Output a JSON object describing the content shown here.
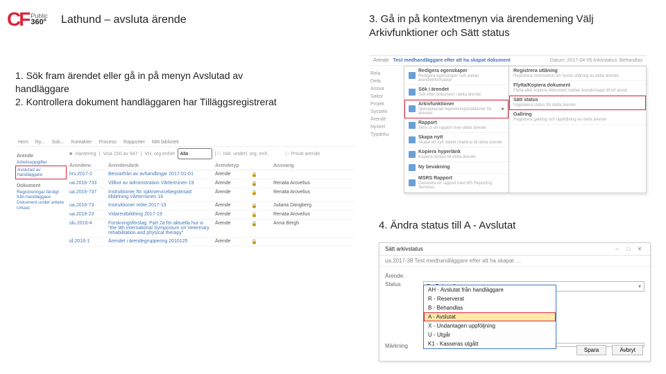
{
  "logo": {
    "mark": "CF",
    "sup": "Public",
    "num": "360°"
  },
  "title": "Lathund – avsluta ärende",
  "step1_lines": "1. Sök fram ärendet eller gå in på menyn Avslutad av handläggare\n2. Kontrollera dokument handläggaren har Tilläggsregistrerat",
  "step3_lines": "3. Gå in på kontextmenyn via ärendemening Välj Arkivfunktioner och Sätt status",
  "step4_lines": "4. Ändra status till A - Avslutat",
  "shot1": {
    "top_tabs": [
      "Hem",
      "Ny...",
      "Sök...",
      "Kontakter",
      "Process",
      "Rapporter",
      "Mitt bibliotek"
    ],
    "side_header": "Ärende",
    "side_items": [
      "Arbetsuppgifter"
    ],
    "side_selected": "Avslutad av handläggare",
    "side_items2": [
      "Dokument",
      "Registreringar färdigt från handläggare",
      "Dokument under arbete",
      "Urkast"
    ],
    "filter": {
      "label": "Hantering",
      "vis": "Visa 150 av 947",
      "scope": "VH, org.enhet",
      "kind": "Alla",
      "check": "Inkl. underl. org. enh.",
      "check2": "Privat arende"
    },
    "cols": [
      "Ärendenr.",
      "Ärenderubrik",
      "Ärendetyp",
      "",
      "Ansvarig"
    ],
    "rows": [
      {
        "id": "hrv.2017-2",
        "t": "Besvarfrån av avhandlingar 2017-01-01",
        "ty": "Ärende",
        "a": ""
      },
      {
        "id": "ua.2016-733",
        "t": "Villkor av administration Vårterminen 19",
        "ty": "Ärende",
        "a": "Renata Arovelius"
      },
      {
        "id": "ua.2016-737",
        "t": "Instruktioner för självservicebegränsad tilldelning Vårterminen 19",
        "ty": "Ärende",
        "a": "Renata Arovelius"
      },
      {
        "id": "ua.2016-73",
        "t": "Instruktioner möte 2017-19",
        "ty": "Ärende",
        "a": "Juliana Dangberg"
      },
      {
        "id": "ua.2016-23",
        "t": "Vidareutbildning 2017-19",
        "ty": "Ärende",
        "a": "Renata Arovelius"
      },
      {
        "id": "slu.2016-4",
        "t": "Forskningsförslag. Part 2a för aktuella hur vi \"the 9th international Symposium on Veterinary rehabilitation and physical therapy\"",
        "ty": "Ärende",
        "a": "Anna Bergh"
      },
      {
        "id": "id.2016-1",
        "t": "Ärendet i ärendegruppering 2010125",
        "ty": "Ärende",
        "a": ""
      }
    ]
  },
  "shot2": {
    "top": "Ärende",
    "case_title": "Test medhandläggare efter att ha skapat dokument",
    "case_date": "Datum: 2017-04-05  Arkivstatus: Behandlas",
    "left_labels": [
      "Rela",
      "Deta",
      "Ansva",
      "Sakor",
      "Projek",
      "Sysselo",
      "Ärende",
      "Nyckel",
      "Typdoku"
    ],
    "menu1": [
      {
        "l": "Redigera egenskaper",
        "s": "Redigera egenskaper och annan ärendeinformation"
      },
      {
        "l": "Sök i ärendet",
        "s": "Sök efter dokument i detta ärende"
      },
      {
        "l": "Arkivfunktioner",
        "s": "Specialiserad registreringsfunktioner för ärendet",
        "sel": true
      },
      {
        "l": "Rapport",
        "s": "Skriv ut en rapport över detta ärende"
      },
      {
        "l": "Skapa nytt",
        "s": "Skapa ett nytt objekt relaterat till detta ärende"
      },
      {
        "l": "Kopiera hyperlänk",
        "s": "Kopiera länken till detta ärende"
      },
      {
        "l": "Ny bevakning",
        "s": ""
      },
      {
        "l": "MSRS Rapport",
        "s": "Generera en rapport med MS Reporting Services"
      }
    ],
    "menu2": [
      {
        "l": "Registrera utlåning",
        "s": "Registrera information om fysisk utlåning av detta ärende"
      },
      {
        "l": "Flytta/Kopiera dokument",
        "s": "Flytta eller kopiera dokument mellan ärendemapp till ett annat"
      },
      {
        "l": "Sätt status",
        "s": "Uppdatera status för detta ärende",
        "sel": true
      },
      {
        "l": "Gallring",
        "s": "Registrera gallring och uppföljning av detta ärende"
      }
    ]
  },
  "shot3": {
    "title": "Sätt arkivstatus",
    "crumb": "ua.2017-38  Test medhandläggare efter att ha skapat …",
    "labels": {
      "arende": "Ärende:",
      "status": "Status",
      "merking": "Märkning"
    },
    "selected": "B - Behandlas",
    "options": [
      "AH - Avslutat från handläggare",
      "R - Reserverat",
      "B - Behandlas",
      "A - Avslutat",
      "X - Undantagen uppföljning",
      "U - Utgår",
      "K1 - Kasseras utgått"
    ],
    "highlight_index": 3,
    "buttons": {
      "save": "Spara",
      "cancel": "Avbryt"
    }
  }
}
